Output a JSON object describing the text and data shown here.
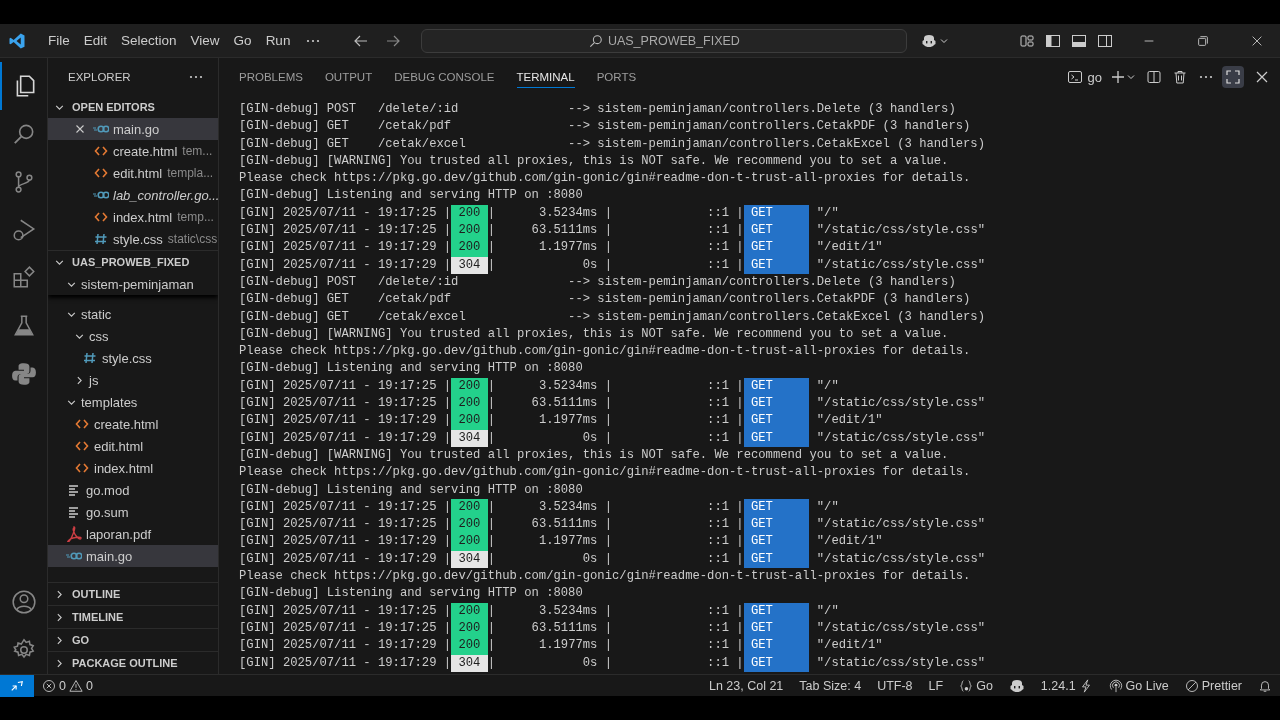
{
  "title_bar": {
    "menu": [
      "File",
      "Edit",
      "Selection",
      "View",
      "Go",
      "Run"
    ],
    "search": "UAS_PROWEB_FIXED"
  },
  "sidebar": {
    "title": "EXPLORER",
    "open_editors": {
      "title": "OPEN EDITORS",
      "expanded": true,
      "items": [
        {
          "name": "main.go",
          "kind": "go",
          "selected": true,
          "preview": false
        },
        {
          "name": "create.html",
          "path": "tem...",
          "kind": "html",
          "selected": false,
          "preview": false
        },
        {
          "name": "edit.html",
          "path": "templa...",
          "kind": "html",
          "selected": false,
          "preview": false
        },
        {
          "name": "lab_controller.go...",
          "kind": "go",
          "selected": false,
          "preview": true
        },
        {
          "name": "index.html",
          "path": "temp...",
          "kind": "html",
          "selected": false,
          "preview": false
        },
        {
          "name": "style.css",
          "path": "static\\css",
          "kind": "css",
          "selected": false,
          "preview": false
        }
      ]
    },
    "workspace": {
      "title": "UAS_PROWEB_FIXED",
      "expanded": true,
      "sticky": {
        "name": "sistem-peminjaman",
        "expanded": true
      },
      "tree": [
        {
          "name": "static",
          "kind": "folder",
          "expanded": true,
          "selected": false,
          "children": [
            {
              "name": "css",
              "kind": "folder",
              "expanded": true,
              "selected": false,
              "children": [
                {
                  "name": "style.css",
                  "kind": "css",
                  "selected": false
                }
              ]
            },
            {
              "name": "js",
              "kind": "folder",
              "expanded": false,
              "selected": false
            }
          ]
        },
        {
          "name": "templates",
          "kind": "folder",
          "expanded": true,
          "selected": false,
          "children": [
            {
              "name": "create.html",
              "kind": "html",
              "selected": false
            },
            {
              "name": "edit.html",
              "kind": "html",
              "selected": false
            },
            {
              "name": "index.html",
              "kind": "html",
              "selected": false
            }
          ]
        },
        {
          "name": "go.mod",
          "kind": "text",
          "selected": false
        },
        {
          "name": "go.sum",
          "kind": "text",
          "selected": false
        },
        {
          "name": "laporan.pdf",
          "kind": "pdf",
          "selected": false
        },
        {
          "name": "main.go",
          "kind": "go",
          "selected": true
        }
      ]
    },
    "sections": [
      {
        "title": "OUTLINE",
        "expanded": false
      },
      {
        "title": "TIMELINE",
        "expanded": false
      },
      {
        "title": "GO",
        "expanded": false
      },
      {
        "title": "PACKAGE OUTLINE",
        "expanded": false
      }
    ]
  },
  "panel": {
    "tabs": [
      {
        "label": "PROBLEMS",
        "selected": false
      },
      {
        "label": "OUTPUT",
        "selected": false
      },
      {
        "label": "DEBUG CONSOLE",
        "selected": false
      },
      {
        "label": "TERMINAL",
        "selected": true
      },
      {
        "label": "PORTS",
        "selected": false
      }
    ],
    "shell": "go",
    "maximized": true
  },
  "terminal": {
    "lines": [
      {
        "kind": "text",
        "text": "[GIN-debug] POST   /delete/:id               --> sistem-peminjaman/controllers.Delete (3 handlers)"
      },
      {
        "kind": "text",
        "text": "[GIN-debug] GET    /cetak/pdf                --> sistem-peminjaman/controllers.CetakPDF (3 handlers)"
      },
      {
        "kind": "text",
        "text": "[GIN-debug] GET    /cetak/excel              --> sistem-peminjaman/controllers.CetakExcel (3 handlers)"
      },
      {
        "kind": "text",
        "text": "[GIN-debug] [WARNING] You trusted all proxies, this is NOT safe. We recommend you to set a value."
      },
      {
        "kind": "text",
        "text": "Please check https://pkg.go.dev/github.com/gin-gonic/gin#readme-don-t-trust-all-proxies for details."
      },
      {
        "kind": "text",
        "text": "[GIN-debug] Listening and serving HTTP on :8080"
      },
      {
        "kind": "log",
        "head": "[GIN] 2025/07/11 - 19:17:25 |",
        "status": {
          "text": "200",
          "color": "#23d18b"
        },
        "mid": "|      3.5234ms |             ::1 |",
        "method": {
          "text": "GET",
          "color": "#2472c8"
        },
        "path": "\"/\""
      },
      {
        "kind": "log",
        "head": "[GIN] 2025/07/11 - 19:17:25 |",
        "status": {
          "text": "200",
          "color": "#23d18b"
        },
        "mid": "|     63.5111ms |             ::1 |",
        "method": {
          "text": "GET",
          "color": "#2472c8"
        },
        "path": "\"/static/css/style.css\""
      },
      {
        "kind": "log",
        "head": "[GIN] 2025/07/11 - 19:17:29 |",
        "status": {
          "text": "200",
          "color": "#23d18b"
        },
        "mid": "|      1.1977ms |             ::1 |",
        "method": {
          "text": "GET",
          "color": "#2472c8"
        },
        "path": "\"/edit/1\""
      },
      {
        "kind": "log",
        "head": "[GIN] 2025/07/11 - 19:17:29 |",
        "status": {
          "text": "304",
          "color": "#e5e5e5"
        },
        "mid": "|            0s |             ::1 |",
        "method": {
          "text": "GET",
          "color": "#2472c8"
        },
        "path": "\"/static/css/style.css\""
      },
      {
        "kind": "text",
        "text": "[GIN-debug] POST   /delete/:id               --> sistem-peminjaman/controllers.Delete (3 handlers)"
      },
      {
        "kind": "text",
        "text": "[GIN-debug] GET    /cetak/pdf                --> sistem-peminjaman/controllers.CetakPDF (3 handlers)"
      },
      {
        "kind": "text",
        "text": "[GIN-debug] GET    /cetak/excel              --> sistem-peminjaman/controllers.CetakExcel (3 handlers)"
      },
      {
        "kind": "text",
        "text": "[GIN-debug] [WARNING] You trusted all proxies, this is NOT safe. We recommend you to set a value."
      },
      {
        "kind": "text",
        "text": "Please check https://pkg.go.dev/github.com/gin-gonic/gin#readme-don-t-trust-all-proxies for details."
      },
      {
        "kind": "text",
        "text": "[GIN-debug] Listening and serving HTTP on :8080"
      },
      {
        "kind": "log",
        "head": "[GIN] 2025/07/11 - 19:17:25 |",
        "status": {
          "text": "200",
          "color": "#23d18b"
        },
        "mid": "|      3.5234ms |             ::1 |",
        "method": {
          "text": "GET",
          "color": "#2472c8"
        },
        "path": "\"/\""
      },
      {
        "kind": "log",
        "head": "[GIN] 2025/07/11 - 19:17:25 |",
        "status": {
          "text": "200",
          "color": "#23d18b"
        },
        "mid": "|     63.5111ms |             ::1 |",
        "method": {
          "text": "GET",
          "color": "#2472c8"
        },
        "path": "\"/static/css/style.css\""
      },
      {
        "kind": "log",
        "head": "[GIN] 2025/07/11 - 19:17:29 |",
        "status": {
          "text": "200",
          "color": "#23d18b"
        },
        "mid": "|      1.1977ms |             ::1 |",
        "method": {
          "text": "GET",
          "color": "#2472c8"
        },
        "path": "\"/edit/1\""
      },
      {
        "kind": "log",
        "head": "[GIN] 2025/07/11 - 19:17:29 |",
        "status": {
          "text": "304",
          "color": "#e5e5e5"
        },
        "mid": "|            0s |             ::1 |",
        "method": {
          "text": "GET",
          "color": "#2472c8"
        },
        "path": "\"/static/css/style.css\""
      },
      {
        "kind": "text",
        "text": "[GIN-debug] [WARNING] You trusted all proxies, this is NOT safe. We recommend you to set a value."
      },
      {
        "kind": "text",
        "text": "Please check https://pkg.go.dev/github.com/gin-gonic/gin#readme-don-t-trust-all-proxies for details."
      },
      {
        "kind": "text",
        "text": "[GIN-debug] Listening and serving HTTP on :8080"
      },
      {
        "kind": "log",
        "head": "[GIN] 2025/07/11 - 19:17:25 |",
        "status": {
          "text": "200",
          "color": "#23d18b"
        },
        "mid": "|      3.5234ms |             ::1 |",
        "method": {
          "text": "GET",
          "color": "#2472c8"
        },
        "path": "\"/\""
      },
      {
        "kind": "log",
        "head": "[GIN] 2025/07/11 - 19:17:25 |",
        "status": {
          "text": "200",
          "color": "#23d18b"
        },
        "mid": "|     63.5111ms |             ::1 |",
        "method": {
          "text": "GET",
          "color": "#2472c8"
        },
        "path": "\"/static/css/style.css\""
      },
      {
        "kind": "log",
        "head": "[GIN] 2025/07/11 - 19:17:29 |",
        "status": {
          "text": "200",
          "color": "#23d18b"
        },
        "mid": "|      1.1977ms |             ::1 |",
        "method": {
          "text": "GET",
          "color": "#2472c8"
        },
        "path": "\"/edit/1\""
      },
      {
        "kind": "log",
        "head": "[GIN] 2025/07/11 - 19:17:29 |",
        "status": {
          "text": "304",
          "color": "#e5e5e5"
        },
        "mid": "|            0s |             ::1 |",
        "method": {
          "text": "GET",
          "color": "#2472c8"
        },
        "path": "\"/static/css/style.css\""
      },
      {
        "kind": "text",
        "text": "Please check https://pkg.go.dev/github.com/gin-gonic/gin#readme-don-t-trust-all-proxies for details."
      },
      {
        "kind": "text",
        "text": "[GIN-debug] Listening and serving HTTP on :8080"
      },
      {
        "kind": "log",
        "head": "[GIN] 2025/07/11 - 19:17:25 |",
        "status": {
          "text": "200",
          "color": "#23d18b"
        },
        "mid": "|      3.5234ms |             ::1 |",
        "method": {
          "text": "GET",
          "color": "#2472c8"
        },
        "path": "\"/\""
      },
      {
        "kind": "log",
        "head": "[GIN] 2025/07/11 - 19:17:25 |",
        "status": {
          "text": "200",
          "color": "#23d18b"
        },
        "mid": "|     63.5111ms |             ::1 |",
        "method": {
          "text": "GET",
          "color": "#2472c8"
        },
        "path": "\"/static/css/style.css\""
      },
      {
        "kind": "log",
        "head": "[GIN] 2025/07/11 - 19:17:29 |",
        "status": {
          "text": "200",
          "color": "#23d18b"
        },
        "mid": "|      1.1977ms |             ::1 |",
        "method": {
          "text": "GET",
          "color": "#2472c8"
        },
        "path": "\"/edit/1\""
      },
      {
        "kind": "log",
        "head": "[GIN] 2025/07/11 - 19:17:29 |",
        "status": {
          "text": "304",
          "color": "#e5e5e5"
        },
        "mid": "|            0s |             ::1 |",
        "method": {
          "text": "GET",
          "color": "#2472c8"
        },
        "path": "\"/static/css/style.css\""
      }
    ]
  },
  "status_bar": {
    "errors": "0",
    "warnings": "0",
    "position": "Ln 23, Col 21",
    "tab_size": "Tab Size: 4",
    "encoding": "UTF-8",
    "eol": "LF",
    "language": "Go",
    "go_version": "1.24.1",
    "live": "Go Live",
    "formatter": "Prettier"
  }
}
